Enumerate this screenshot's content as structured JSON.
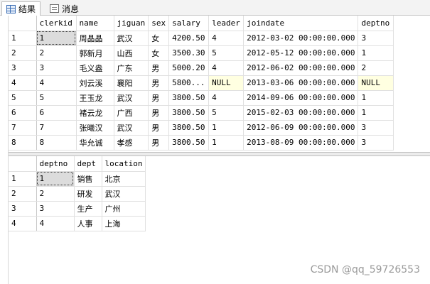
{
  "tabs": [
    {
      "label": "结果",
      "icon": "grid-icon",
      "active": true
    },
    {
      "label": "消息",
      "icon": "messages-icon",
      "active": false
    }
  ],
  "result1": {
    "columns": [
      "clerkid",
      "name",
      "jiguan",
      "sex",
      "salary",
      "leader",
      "joindate",
      "deptno"
    ],
    "rows": [
      [
        "1",
        "1",
        "周晶晶",
        "武汉",
        "女",
        "4200.50",
        "4",
        "2012-03-02 00:00:00.000",
        "3"
      ],
      [
        "2",
        "2",
        "郭新月",
        "山西",
        "女",
        "3500.30",
        "5",
        "2012-05-12 00:00:00.000",
        "1"
      ],
      [
        "3",
        "3",
        "毛义盎",
        "广东",
        "男",
        "5000.20",
        "4",
        "2012-06-02 00:00:00.000",
        "2"
      ],
      [
        "4",
        "4",
        "刘云溪",
        "襄阳",
        "男",
        "5800...",
        "NULL",
        "2013-03-06 00:00:00.000",
        "NULL"
      ],
      [
        "5",
        "5",
        "王玉龙",
        "武汉",
        "男",
        "3800.50",
        "4",
        "2014-09-06 00:00:00.000",
        "1"
      ],
      [
        "6",
        "6",
        "褚云龙",
        "广西",
        "男",
        "3800.50",
        "5",
        "2015-02-03 00:00:00.000",
        "1"
      ],
      [
        "7",
        "7",
        "张曦汉",
        "武汉",
        "男",
        "3800.50",
        "1",
        "2012-06-09 00:00:00.000",
        "3"
      ],
      [
        "8",
        "8",
        "华允诚",
        "孝感",
        "男",
        "3800.50",
        "1",
        "2013-08-09 00:00:00.000",
        "3"
      ]
    ]
  },
  "result2": {
    "columns": [
      "deptno",
      "dept",
      "location"
    ],
    "rows": [
      [
        "1",
        "1",
        "销售",
        "北京"
      ],
      [
        "2",
        "2",
        "研发",
        "武汉"
      ],
      [
        "3",
        "3",
        "生产",
        "广州"
      ],
      [
        "4",
        "4",
        "人事",
        "上海"
      ]
    ]
  },
  "watermark": "CSDN @qq_59726553"
}
